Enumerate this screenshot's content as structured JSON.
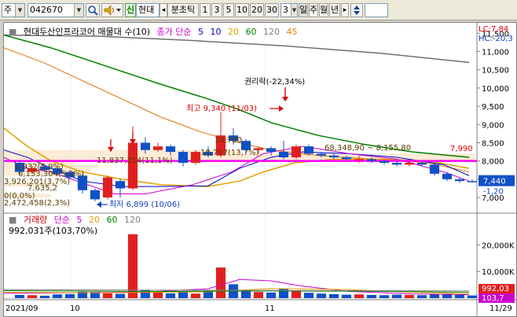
{
  "toolbar": {
    "market_label": "주",
    "stock_code": "042670",
    "search_icon": "magnifier-icon",
    "sound_icon": "speaker-icon",
    "credit_badge": "신",
    "stock_name": "현대",
    "prev_arrow": "◂",
    "period_label": "분초틱",
    "periods": [
      "1",
      "3",
      "5",
      "10",
      "20",
      "30"
    ],
    "period_value": "3",
    "period_units": [
      "일",
      "주",
      "월",
      "년"
    ],
    "next_arrow": "▸",
    "updown_icon": "up-down-arrows-icon"
  },
  "price_panel": {
    "title": "현대두산인프라코어 매물대 수(10)",
    "ma_label": "종가 단순",
    "ma_periods": [
      {
        "label": "5",
        "color": "#0000cc"
      },
      {
        "label": "10",
        "color": "#0000cc"
      },
      {
        "label": "20",
        "color": "#e0a000"
      },
      {
        "label": "60",
        "color": "#008000"
      },
      {
        "label": "120",
        "color": "#808080"
      },
      {
        "label": "45",
        "color": "#e08000"
      }
    ],
    "lc_label": "LC:7,84",
    "hc_label": "HC:-20,3",
    "last_price": "7,440",
    "last_change": "-1,20",
    "high_annotation": "최고 9,340 (11/03)",
    "low_annotation": "최저 6,899 (10/06)",
    "event_annotation": "권리락(-22,34%)",
    "right_price_label": "7,990",
    "level_labels": [
      "19,780",
      "18,797(13,7%)",
      "11,837,314(11,1%)",
      "6,932(5,9%)",
      "6,153,304(5,9%)",
      "3,926,201(3,7%)",
      "7,635,2",
      "0(0,0%)",
      "2,472,458(2,3%)",
      "68,348,90 ~ 8,155,80"
    ],
    "y_ticks": [
      "11,500",
      "11,000",
      "10,500",
      "10,000",
      "9,500",
      "9,000",
      "8,500",
      "8,000",
      "7,500",
      "7,000"
    ]
  },
  "volume_panel": {
    "title": "거래량",
    "ma_label": "단순",
    "ma_periods": [
      {
        "label": "5",
        "color": "#cc00cc"
      },
      {
        "label": "20",
        "color": "#e0a000"
      },
      {
        "label": "60",
        "color": "#008000"
      },
      {
        "label": "120",
        "color": "#808080"
      }
    ],
    "current": "992,031주(103,70%)",
    "y_ticks": [
      "20,000K",
      "10,000K"
    ],
    "last_value": "992,03",
    "last_pct": "103,7"
  },
  "x_axis": {
    "labels": [
      "2021/09",
      "10",
      "11",
      "11/29"
    ]
  },
  "chart_data": {
    "type": "candlestick",
    "title": "현대두산인프라코어 매물대 수(10)",
    "ylim": [
      6700,
      11700
    ],
    "candles": [
      {
        "o": 7950,
        "c": 7700,
        "h": 8020,
        "l": 7620
      },
      {
        "o": 7700,
        "c": 7800,
        "h": 7860,
        "l": 7650
      },
      {
        "o": 7850,
        "c": 7750,
        "h": 7900,
        "l": 7700
      },
      {
        "o": 7800,
        "c": 7650,
        "h": 7850,
        "l": 7600
      },
      {
        "o": 7700,
        "c": 7550,
        "h": 7750,
        "l": 7500
      },
      {
        "o": 7600,
        "c": 7200,
        "h": 7650,
        "l": 7100
      },
      {
        "o": 7200,
        "c": 6950,
        "h": 7250,
        "l": 6899
      },
      {
        "o": 7000,
        "c": 7550,
        "h": 7600,
        "l": 6950
      },
      {
        "o": 7450,
        "c": 7250,
        "h": 7500,
        "l": 7000
      },
      {
        "o": 7250,
        "c": 8500,
        "h": 8950,
        "l": 7200
      },
      {
        "o": 8500,
        "c": 8300,
        "h": 8650,
        "l": 8200
      },
      {
        "o": 8300,
        "c": 8400,
        "h": 8500,
        "l": 8250
      },
      {
        "o": 8400,
        "c": 8250,
        "h": 8450,
        "l": 8150
      },
      {
        "o": 8250,
        "c": 7950,
        "h": 8300,
        "l": 7850
      },
      {
        "o": 7950,
        "c": 8250,
        "h": 8300,
        "l": 7900
      },
      {
        "o": 8250,
        "c": 8150,
        "h": 8400,
        "l": 8100
      },
      {
        "o": 8150,
        "c": 8700,
        "h": 9340,
        "l": 8100
      },
      {
        "o": 8700,
        "c": 8550,
        "h": 8900,
        "l": 8450
      },
      {
        "o": 8550,
        "c": 8300,
        "h": 8600,
        "l": 8200
      },
      {
        "o": 8300,
        "c": 8350,
        "h": 8400,
        "l": 8200
      },
      {
        "o": 8350,
        "c": 8250,
        "h": 8400,
        "l": 8150
      },
      {
        "o": 8250,
        "c": 8100,
        "h": 8550,
        "l": 8050
      },
      {
        "o": 8100,
        "c": 8400,
        "h": 8450,
        "l": 8050
      },
      {
        "o": 8400,
        "c": 8200,
        "h": 8450,
        "l": 8150
      },
      {
        "o": 8200,
        "c": 8150,
        "h": 8250,
        "l": 8100
      },
      {
        "o": 8150,
        "c": 8100,
        "h": 8200,
        "l": 8050
      },
      {
        "o": 8100,
        "c": 8050,
        "h": 8150,
        "l": 8000
      },
      {
        "o": 8050,
        "c": 8050,
        "h": 8150,
        "l": 7950
      },
      {
        "o": 8050,
        "c": 8000,
        "h": 8100,
        "l": 7950
      },
      {
        "o": 8000,
        "c": 7950,
        "h": 8050,
        "l": 7900
      },
      {
        "o": 7950,
        "c": 7900,
        "h": 8000,
        "l": 7850
      },
      {
        "o": 7900,
        "c": 7950,
        "h": 8000,
        "l": 7850
      },
      {
        "o": 7950,
        "c": 7900,
        "h": 7980,
        "l": 7850
      },
      {
        "o": 7900,
        "c": 7650,
        "h": 7950,
        "l": 7600
      },
      {
        "o": 7650,
        "c": 7500,
        "h": 7700,
        "l": 7450
      },
      {
        "o": 7500,
        "c": 7450,
        "h": 7550,
        "l": 7400
      },
      {
        "o": 7450,
        "c": 7440,
        "h": 7500,
        "l": 7400
      }
    ],
    "volume_k": [
      1200,
      1100,
      900,
      1400,
      1500,
      2400,
      2300,
      1800,
      1600,
      24000,
      3000,
      2200,
      1800,
      2600,
      1700,
      2900,
      11500,
      5200,
      2800,
      2300,
      2100,
      3400,
      2600,
      2000,
      1700,
      1500,
      1300,
      1400,
      1200,
      1100,
      1300,
      1200,
      1100,
      1500,
      1600,
      1200,
      992
    ],
    "volume_ylim": [
      0,
      26000
    ],
    "horizontal_level": 8000
  }
}
